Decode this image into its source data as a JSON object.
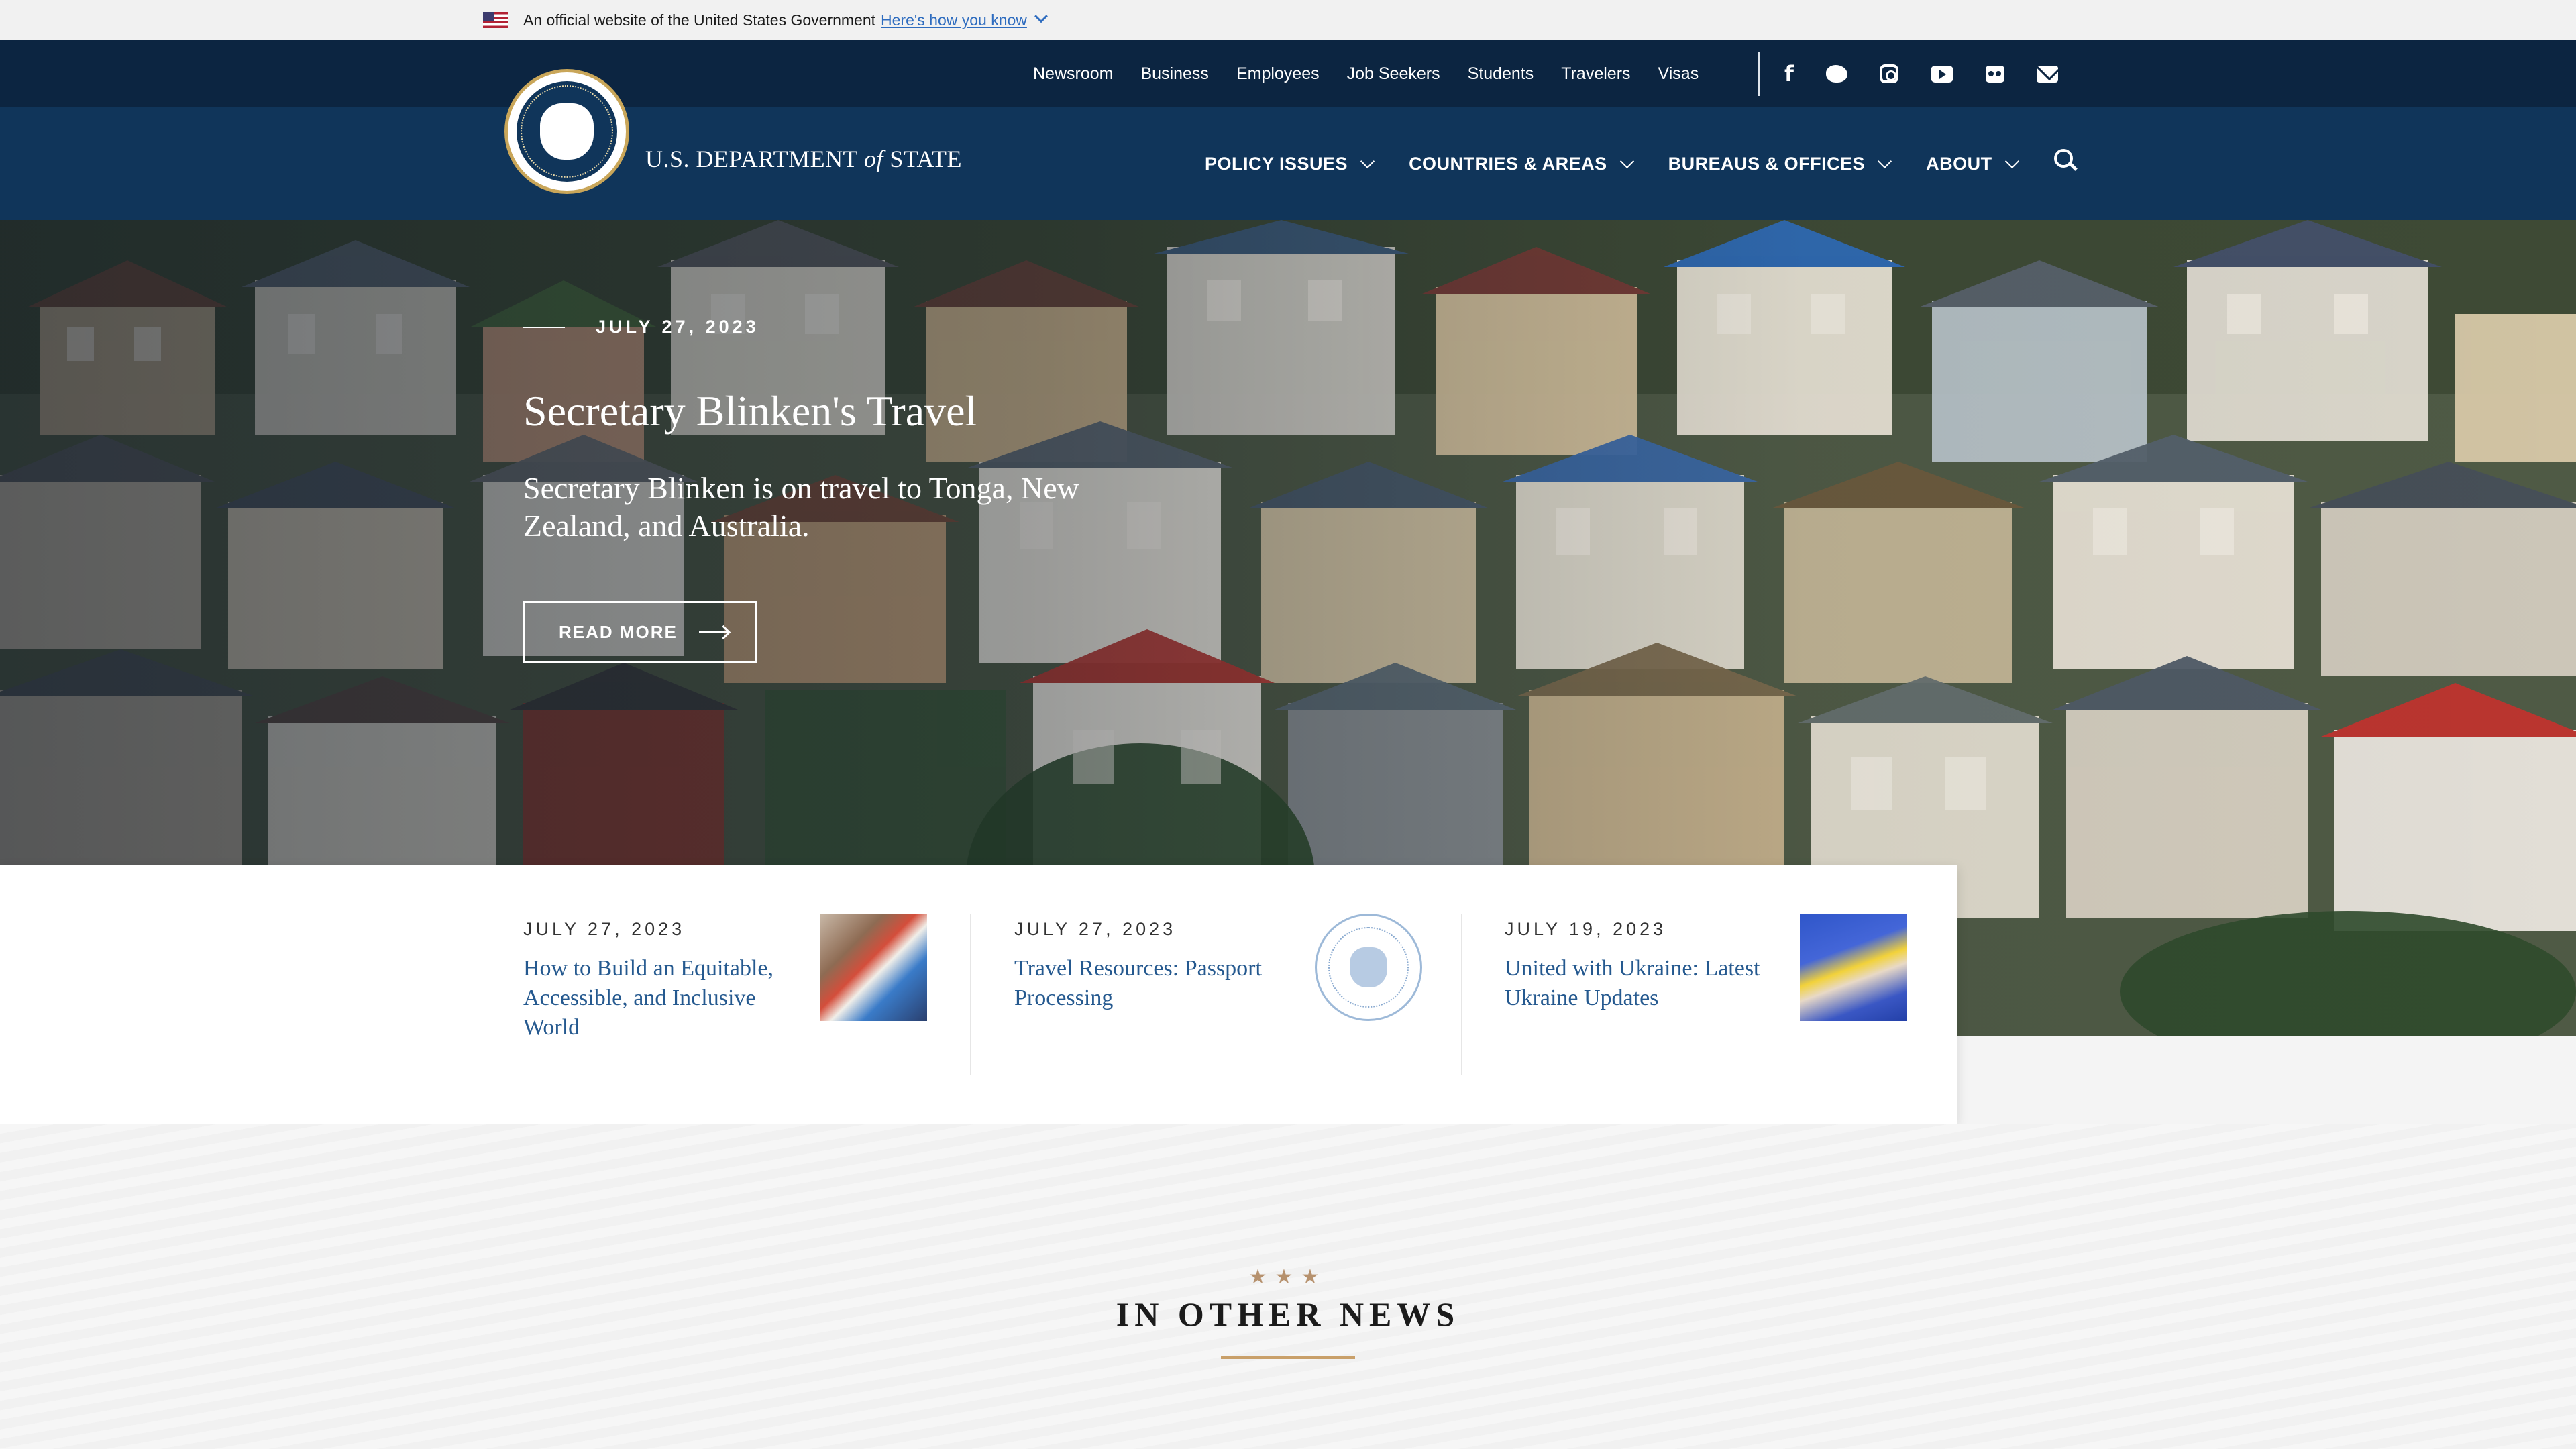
{
  "gov_banner": {
    "text": "An official website of the United States Government",
    "link": "Here's how you know"
  },
  "utility_nav": {
    "links": [
      "Newsroom",
      "Business",
      "Employees",
      "Job Seekers",
      "Students",
      "Travelers",
      "Visas"
    ],
    "social_icons": [
      "facebook-icon",
      "twitter-icon",
      "instagram-icon",
      "youtube-icon",
      "flickr-icon",
      "email-icon"
    ]
  },
  "header": {
    "title_prefix": "U.S. DEPARTMENT",
    "title_of": "of",
    "title_suffix": "STATE",
    "nav": [
      "POLICY ISSUES",
      "COUNTRIES & AREAS",
      "BUREAUS & OFFICES",
      "ABOUT"
    ]
  },
  "hero": {
    "date": "JULY 27, 2023",
    "title": "Secretary Blinken's Travel",
    "description": "Secretary Blinken is on travel to Tonga, New Zealand, and Australia.",
    "button": "READ MORE"
  },
  "cards": [
    {
      "date": "JULY 27, 2023",
      "title": "How to Build an Equitable, Accessible, and Inclusive World"
    },
    {
      "date": "JULY 27, 2023",
      "title": "Travel Resources: Passport Processing"
    },
    {
      "date": "JULY 19, 2023",
      "title": "United with Ukraine: Latest Ukraine Updates"
    }
  ],
  "other_news": {
    "stars": "★★★",
    "heading": "IN OTHER NEWS"
  },
  "colors": {
    "navy_dark": "#0c2541",
    "navy": "#10355a",
    "link_blue": "#25598f",
    "gold": "#c9a06a"
  }
}
